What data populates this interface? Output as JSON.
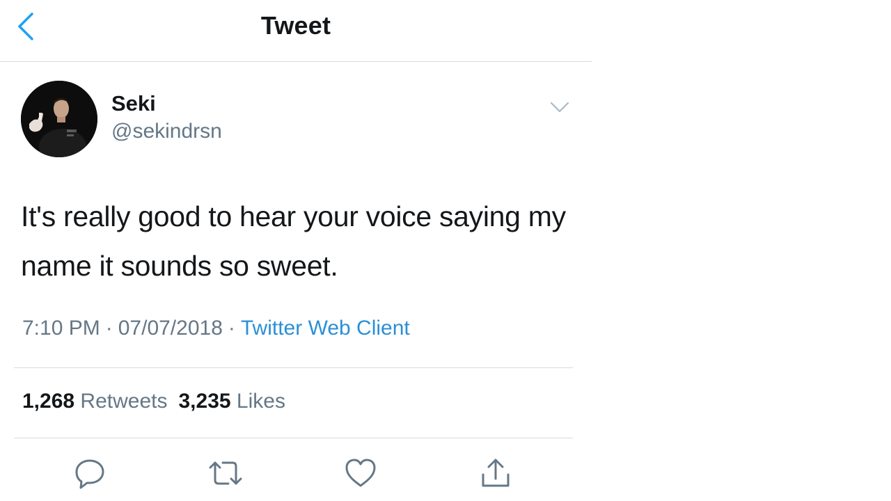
{
  "header": {
    "title": "Tweet"
  },
  "author": {
    "display_name": "Seki",
    "handle": "@sekindrsn"
  },
  "tweet": {
    "text": "It's really good to hear your voice saying my name it sounds so sweet.",
    "time": "7:10 PM",
    "date": "07/07/2018",
    "separator": "·",
    "client": "Twitter Web Client"
  },
  "stats": {
    "retweets_count": "1,268",
    "retweets_label": "Retweets",
    "likes_count": "3,235",
    "likes_label": "Likes"
  },
  "icons": {
    "back": "chevron-left-icon",
    "more": "chevron-down-icon",
    "reply": "reply-icon",
    "retweet": "retweet-icon",
    "like": "heart-icon",
    "share": "share-icon"
  },
  "colors": {
    "accent": "#1da1f2",
    "text": "#14171a",
    "secondary": "#657786",
    "divider": "#d6d9dc"
  }
}
